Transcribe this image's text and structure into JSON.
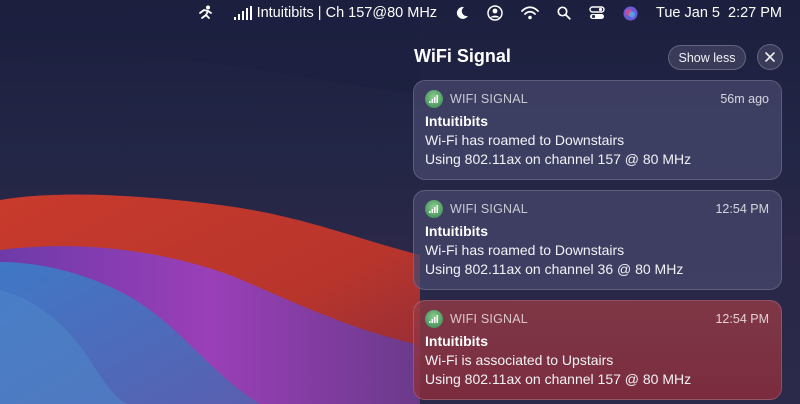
{
  "menubar": {
    "wifi_status": "Intuitibits | Ch 157@80 MHz",
    "date": "Tue Jan 5",
    "time": "2:27 PM"
  },
  "panel": {
    "title": "WiFi Signal",
    "show_less_label": "Show less"
  },
  "notifications": [
    {
      "app": "WIFI SIGNAL",
      "time": "56m ago",
      "title": "Intuitibits",
      "line1": "Wi-Fi has roamed to Downstairs",
      "line2": "Using 802.11ax on channel 157 @ 80 MHz"
    },
    {
      "app": "WIFI SIGNAL",
      "time": "12:54 PM",
      "title": "Intuitibits",
      "line1": "Wi-Fi has roamed to Downstairs",
      "line2": "Using 802.11ax on channel 36 @ 80 MHz"
    },
    {
      "app": "WIFI SIGNAL",
      "time": "12:54 PM",
      "title": "Intuitibits",
      "line1": "Wi-Fi is associated to Upstairs",
      "line2": "Using 802.11ax on channel 157 @ 80 MHz"
    }
  ]
}
